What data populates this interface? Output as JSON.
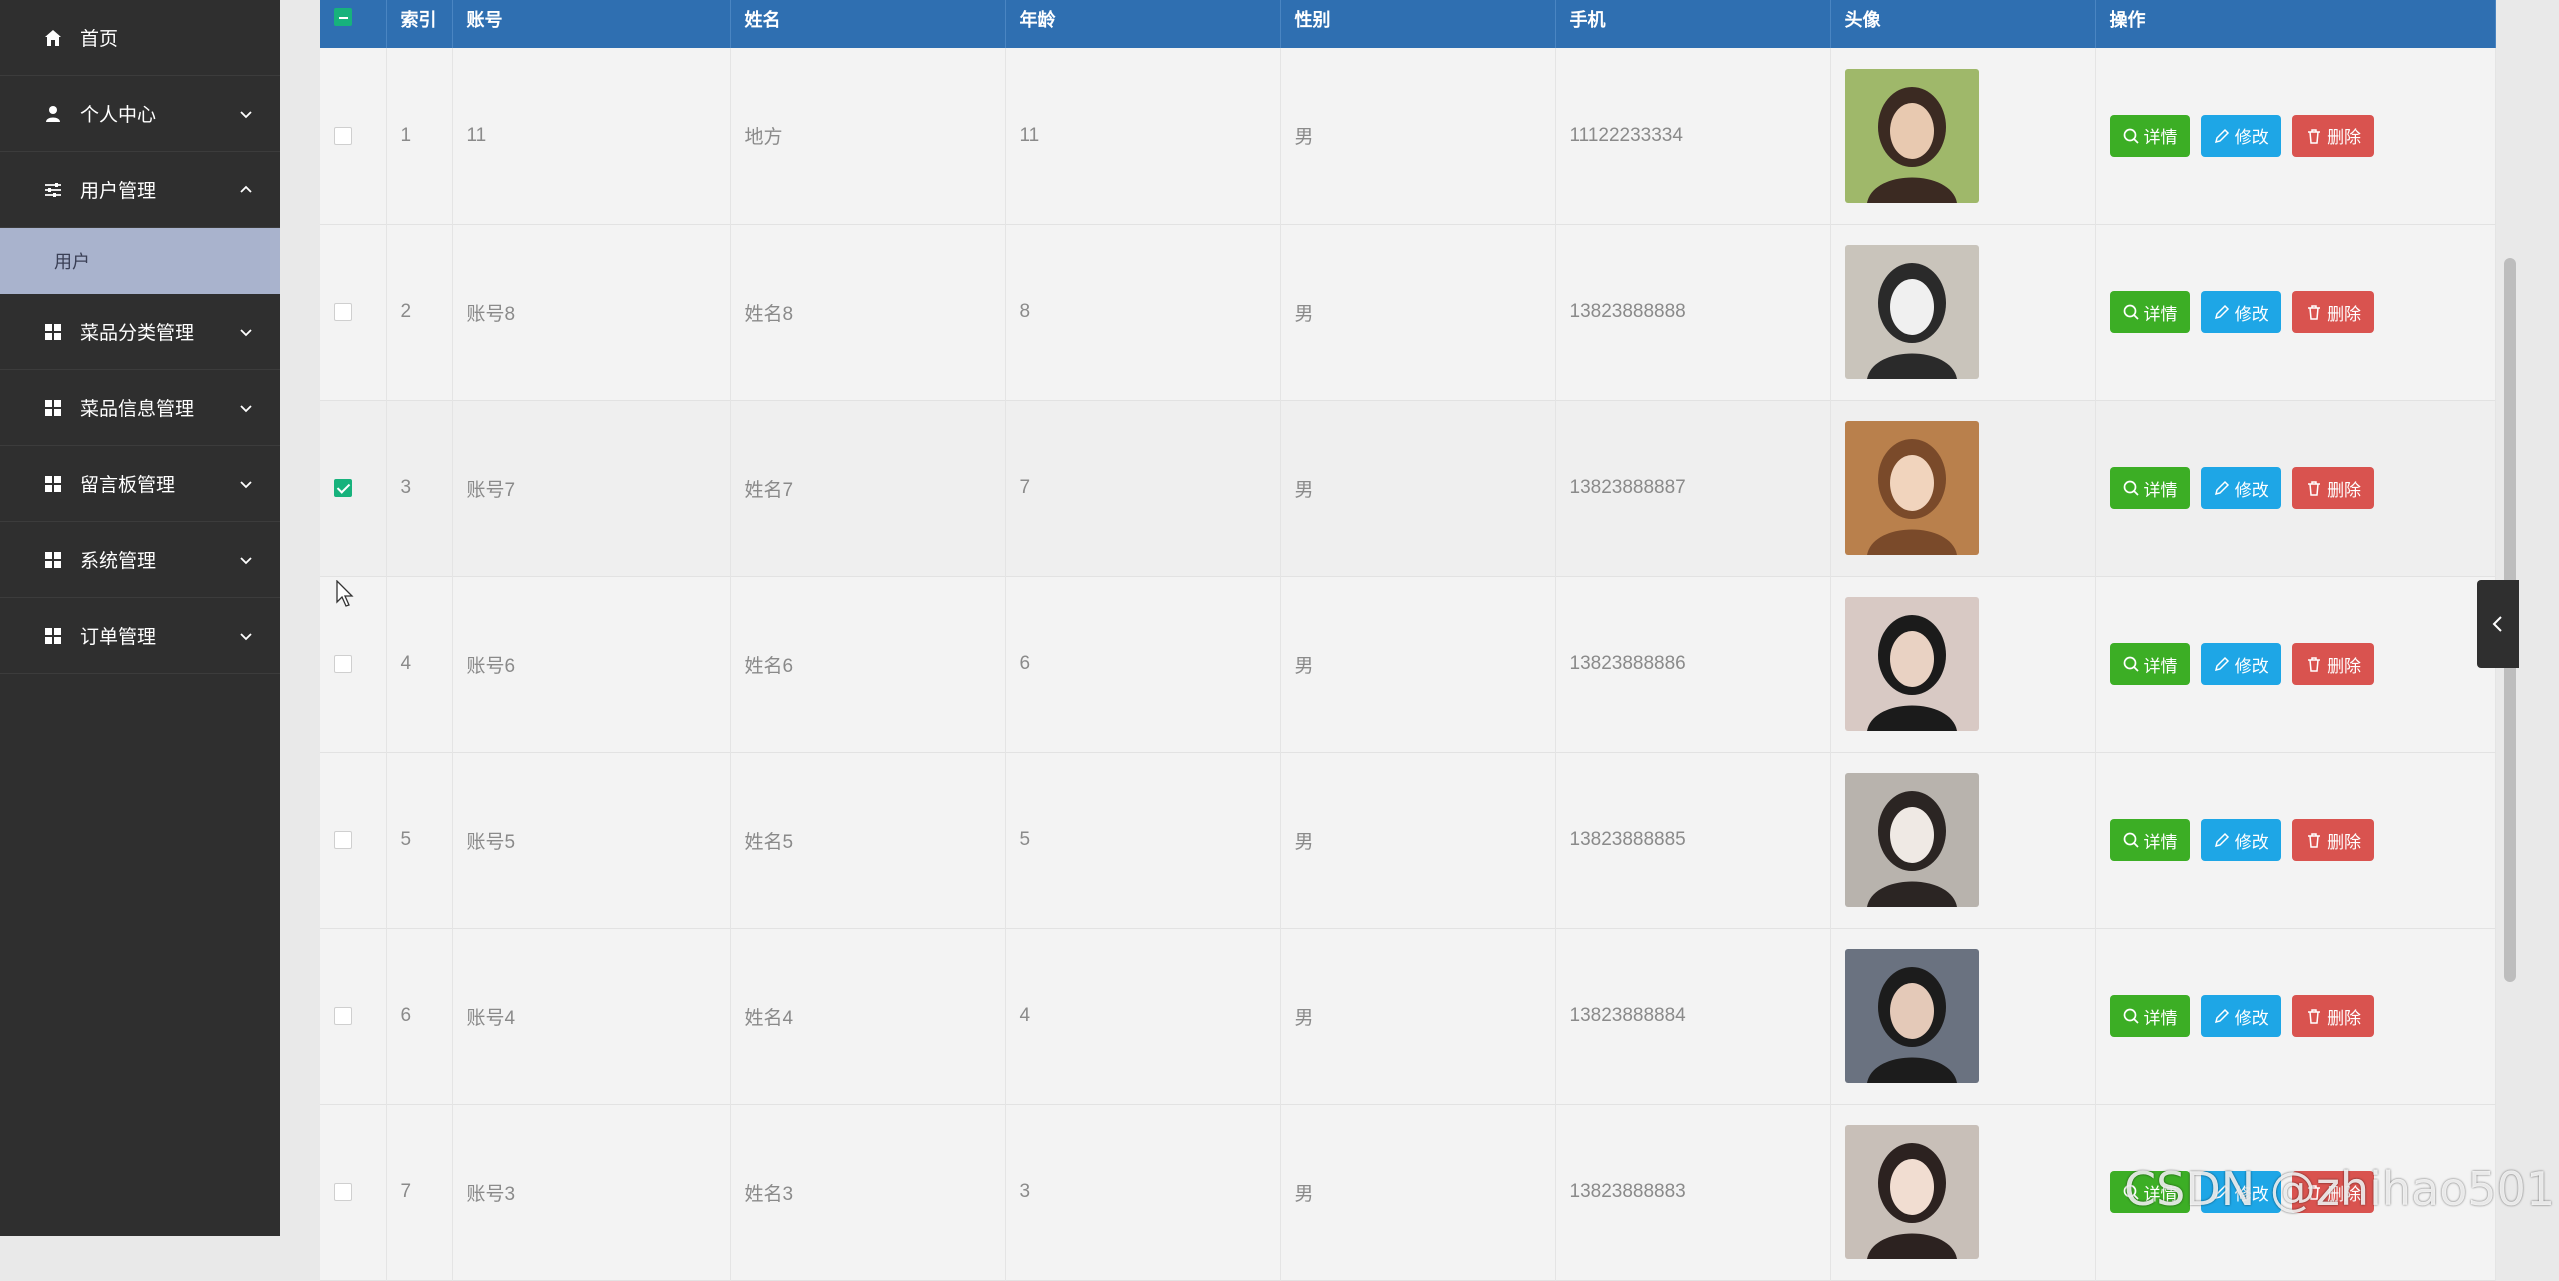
{
  "sidebar": {
    "items": [
      {
        "label": "首页",
        "icon": "home-icon",
        "expandable": false
      },
      {
        "label": "个人中心",
        "icon": "user-icon",
        "expandable": true,
        "expanded": false
      },
      {
        "label": "用户管理",
        "icon": "sliders-icon",
        "expandable": true,
        "expanded": true
      },
      {
        "label": "菜品分类管理",
        "icon": "grid-icon",
        "expandable": true,
        "expanded": false
      },
      {
        "label": "菜品信息管理",
        "icon": "grid-icon",
        "expandable": true,
        "expanded": false
      },
      {
        "label": "留言板管理",
        "icon": "grid-icon",
        "expandable": true,
        "expanded": false
      },
      {
        "label": "系统管理",
        "icon": "grid-icon",
        "expandable": true,
        "expanded": false
      },
      {
        "label": "订单管理",
        "icon": "grid-icon",
        "expandable": true,
        "expanded": false
      }
    ],
    "submenu": {
      "label": "用户"
    }
  },
  "table": {
    "headers": {
      "index": "索引",
      "account": "账号",
      "name": "姓名",
      "age": "年龄",
      "gender": "性别",
      "phone": "手机",
      "avatar": "头像",
      "actions": "操作"
    },
    "actions": {
      "detail": "详情",
      "edit": "修改",
      "delete": "删除"
    },
    "rows": [
      {
        "index": "1",
        "account": "11",
        "name": "地方",
        "age": "11",
        "gender": "男",
        "phone": "11122233334",
        "checked": false
      },
      {
        "index": "2",
        "account": "账号8",
        "name": "姓名8",
        "age": "8",
        "gender": "男",
        "phone": "13823888888",
        "checked": false
      },
      {
        "index": "3",
        "account": "账号7",
        "name": "姓名7",
        "age": "7",
        "gender": "男",
        "phone": "13823888887",
        "checked": true
      },
      {
        "index": "4",
        "account": "账号6",
        "name": "姓名6",
        "age": "6",
        "gender": "男",
        "phone": "13823888886",
        "checked": false
      },
      {
        "index": "5",
        "account": "账号5",
        "name": "姓名5",
        "age": "5",
        "gender": "男",
        "phone": "13823888885",
        "checked": false
      },
      {
        "index": "6",
        "account": "账号4",
        "name": "姓名4",
        "age": "4",
        "gender": "男",
        "phone": "13823888884",
        "checked": false
      },
      {
        "index": "7",
        "account": "账号3",
        "name": "姓名3",
        "age": "3",
        "gender": "男",
        "phone": "13823888883",
        "checked": false
      }
    ]
  },
  "watermark": "CSDN @zhihao501",
  "colors": {
    "sidebar_bg": "#2f2f2f",
    "submenu_active_bg": "#a9b3cd",
    "header_bg": "#2f6fb1",
    "checkbox_checked": "#17b27c",
    "btn_detail": "#3cae25",
    "btn_edit": "#1ea6e6",
    "btn_delete": "#d9534f"
  }
}
